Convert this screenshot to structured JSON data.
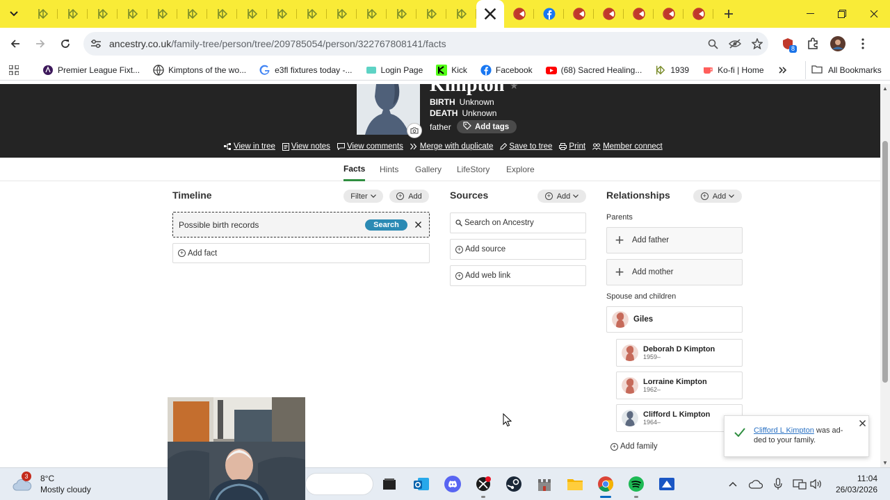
{
  "browser": {
    "tab_count_ancestry": 16,
    "url_domain": "ancestry.co.uk",
    "url_path": "/family-tree/person/tree/209785054/person/322767808141/facts",
    "extension_badge": "8",
    "bookmarks": [
      {
        "label": "Premier League Fixt...",
        "icon": "premier-league-icon"
      },
      {
        "label": "Kimptons of the wo...",
        "icon": "globe-icon"
      },
      {
        "label": "e3fl fixtures today -...",
        "icon": "google-icon"
      },
      {
        "label": "Login Page",
        "icon": "login-icon"
      },
      {
        "label": "Kick",
        "icon": "kick-icon"
      },
      {
        "label": "Facebook",
        "icon": "facebook-icon"
      },
      {
        "label": "(68) Sacred Healing...",
        "icon": "youtube-icon"
      },
      {
        "label": "1939",
        "icon": "ancestry-leaf-icon"
      },
      {
        "label": "Ko-fi | Home",
        "icon": "kofi-icon"
      }
    ],
    "all_bookmarks": "All Bookmarks"
  },
  "person": {
    "name": "Kimpton",
    "birth_label": "BIRTH",
    "birth_value": "Unknown",
    "death_label": "DEATH",
    "death_value": "Unknown",
    "relation": "father",
    "add_tags": "Add tags",
    "actions": [
      "View in tree",
      "View notes",
      "View comments",
      "Merge with duplicate",
      "Save to tree",
      "Print",
      "Member connect"
    ]
  },
  "tabs": [
    "Facts",
    "Hints",
    "Gallery",
    "LifeStory",
    "Explore"
  ],
  "timeline": {
    "title": "Timeline",
    "filter": "Filter",
    "add": "Add",
    "birth_card": "Possible birth records",
    "birth_search": "Search",
    "add_fact": "Add fact"
  },
  "sources": {
    "title": "Sources",
    "add": "Add",
    "search": "Search on Ancestry",
    "add_source": "Add source",
    "add_web_link": "Add web link"
  },
  "relationships": {
    "title": "Relationships",
    "add": "Add",
    "parents_label": "Parents",
    "add_father": "Add father",
    "add_mother": "Add mother",
    "spouse_label": "Spouse and children",
    "spouse": "Giles",
    "children": [
      {
        "name": "Deborah D Kimpton",
        "years": "1959–",
        "avatar": "female"
      },
      {
        "name": "Lorraine Kimpton",
        "years": "1962–",
        "avatar": "female"
      },
      {
        "name": "Clifford L Kimpton",
        "years": "1964–",
        "avatar": "male"
      }
    ],
    "add_family": "Add family"
  },
  "toast": {
    "link": "Clifford L Kimpton",
    "text1": " was ad-",
    "text2": "ded to your family."
  },
  "taskbar": {
    "weather_badge": "3",
    "temperature": "8°C",
    "condition": "Mostly cloudy",
    "time": "11:04",
    "date": "26/03/2026"
  },
  "colors": {
    "tab_strip": "#f9eb37",
    "header_bg": "#242424",
    "active_tab_underline": "#2f8e40",
    "search_button": "#2b8ab4",
    "female_avatar": "#c66a5a",
    "male_avatar": "#5d6a80"
  }
}
